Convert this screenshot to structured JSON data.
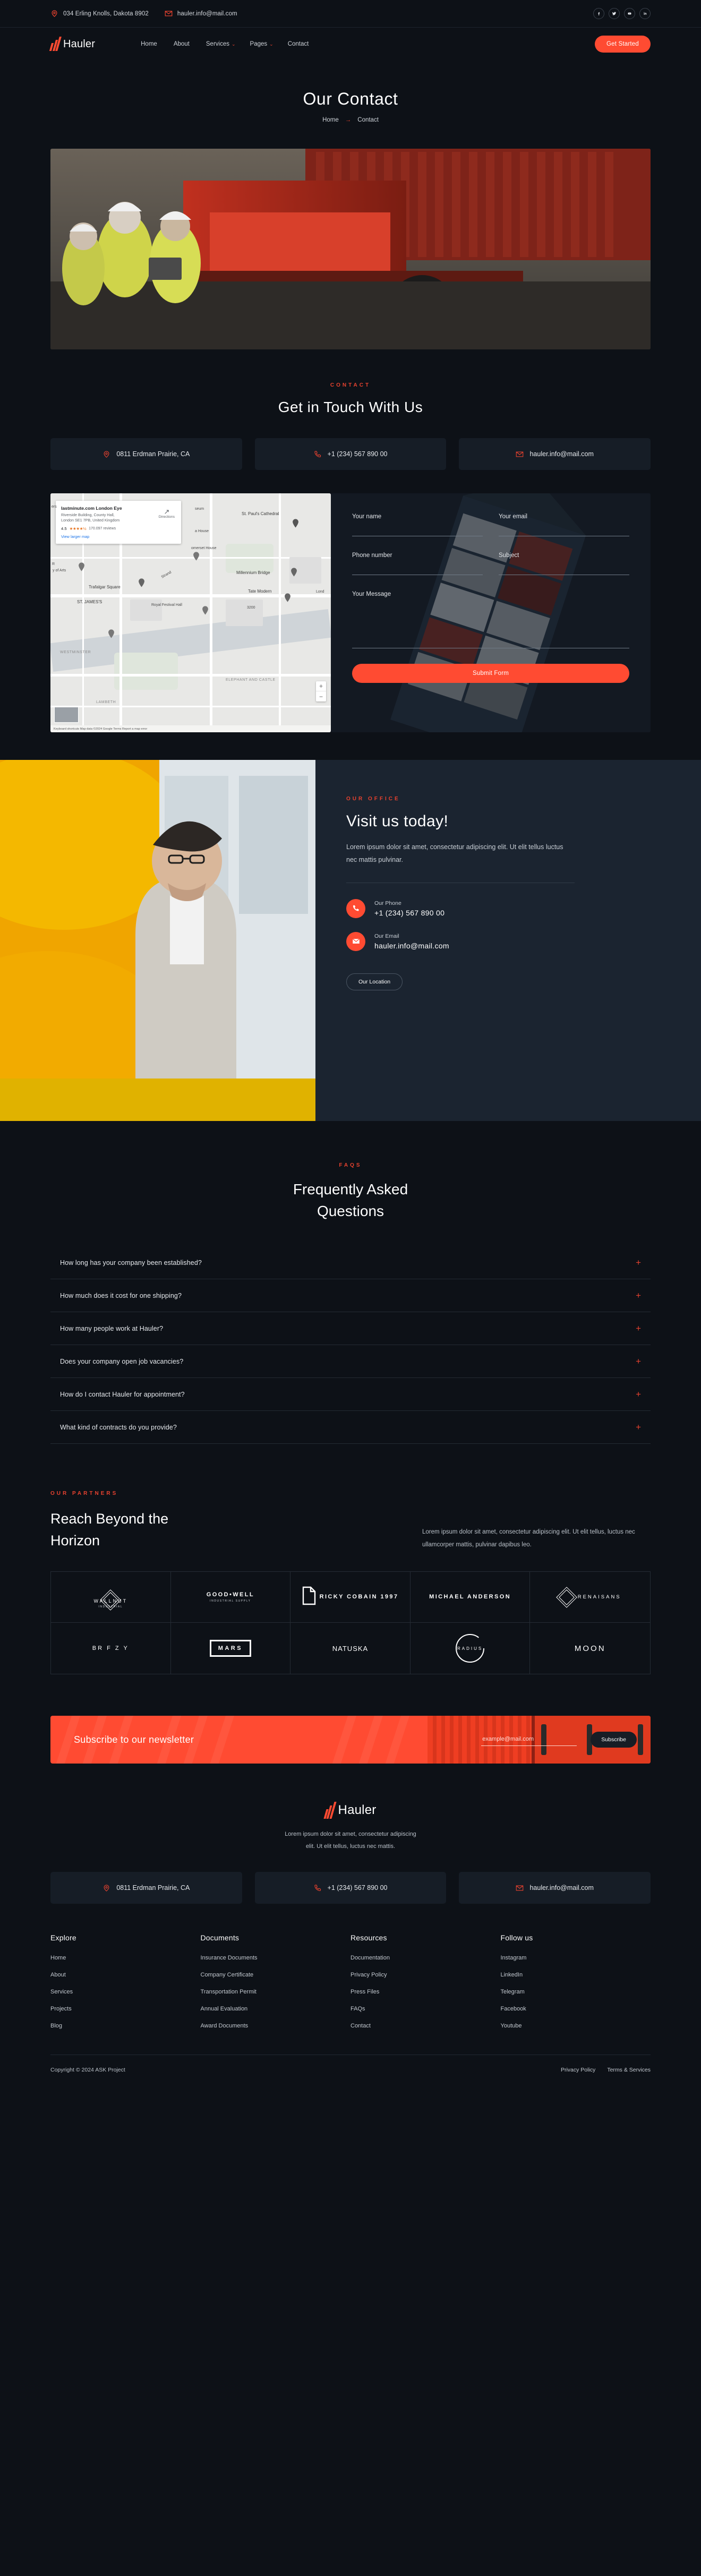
{
  "colors": {
    "accent": "#ff4b32",
    "accent_dark": "#e8422f",
    "bg": "#0d1117",
    "panel": "#161d26",
    "card": "#1b2430"
  },
  "topbar": {
    "address": "034 Erling Knolls, Dakota 8902",
    "email": "hauler.info@mail.com",
    "socials": [
      "facebook",
      "twitter",
      "youtube",
      "linkedin"
    ]
  },
  "nav": {
    "brand": "Hauler",
    "links": [
      {
        "label": "Home",
        "caret": ""
      },
      {
        "label": "About",
        "caret": ""
      },
      {
        "label": "Services",
        "caret": "⌄"
      },
      {
        "label": "Pages",
        "caret": "⌄"
      },
      {
        "label": "Contact",
        "caret": ""
      }
    ],
    "cta": "Get Started"
  },
  "hero": {
    "title": "Our Contact",
    "crumb_home": "Home",
    "crumb_arrow": "→",
    "crumb_current": "Contact"
  },
  "contact": {
    "eyebrow": "CONTACT",
    "title": "Get in Touch With Us",
    "cards": [
      {
        "icon": "location-pin-icon",
        "text": "0811 Erdman Prairie, CA"
      },
      {
        "icon": "phone-icon",
        "text": "+1 (234) 567 890 00"
      },
      {
        "icon": "envelope-icon",
        "text": "hauler.info@mail.com"
      }
    ]
  },
  "map": {
    "place_title": "lastminute.com London Eye",
    "address_line1": "Riverside Building, County Hall,",
    "address_line2": "London SE1 7PB, United Kingdom",
    "rating": "4.5",
    "stars": "★★★★½",
    "reviews": "170.097 reviews",
    "view_larger": "View larger map",
    "directions": "Directions",
    "zoom_in": "+",
    "zoom_out": "−",
    "footer_text": "Keyboard shortcuts   Map data ©2024 Google   Terms   Report a map error",
    "labels": [
      "Primark",
      "seum",
      "a House",
      "St. Paul's Cathedral",
      "omerset House",
      "Millennium Bridge",
      "Tate Modern",
      "Lond",
      "y of Arts",
      "Trafalgar Square",
      "Strand",
      "ST. JAMES'S",
      "Royal Festival Hall",
      "WESTMINSTER",
      "LAMBETH",
      "ELEPHANT AND CASTLE",
      "3200",
      "ers",
      "R"
    ]
  },
  "form": {
    "name_label": "Your name",
    "email_label": "Your email",
    "phone_label": "Phone number",
    "subject_label": "Subject",
    "message_label": "Your Message",
    "name_value": "",
    "email_value": "",
    "phone_value": "",
    "subject_value": "",
    "message_value": "",
    "submit": "Submit Form"
  },
  "office": {
    "eyebrow": "OUR OFFICE",
    "title": "Visit us today!",
    "lead": "Lorem ipsum dolor sit amet, consectetur adipiscing elit. Ut elit tellus luctus nec mattis pulvinar.",
    "phone_label": "Our Phone",
    "phone_value": "+1 (234) 567 890 00",
    "email_label": "Our Email",
    "email_value": "hauler.info@mail.com",
    "button": "Our Location"
  },
  "faq": {
    "eyebrow": "FAQS",
    "title_line1": "Frequently Asked",
    "title_line2": "Questions",
    "items": [
      "How long has your company been established?",
      "How much does it cost for one shipping?",
      "How many people work at Hauler?",
      "Does your company open job vacancies?",
      "How do I contact Hauler for appointment?",
      "What kind of contracts do you provide?"
    ],
    "expand_glyph": "+"
  },
  "partners": {
    "eyebrow": "OUR PARTNERS",
    "title_line1": "Reach Beyond the",
    "title_line2": "Horizon",
    "paragraph": "Lorem ipsum dolor sit amet, consectetur adipiscing elit. Ut elit tellus, luctus nec ullamcorper mattis, pulvinar dapibus leo.",
    "logos": [
      {
        "name": "WALLNUT",
        "sub": "INDUSTRIAL",
        "style": "diamond"
      },
      {
        "name": "GOOD•WELL",
        "sub": "INDUSTRIAL SUPPLY",
        "style": "stacked"
      },
      {
        "name": "RICKY COBAIN 1997",
        "sub": "",
        "style": "doc"
      },
      {
        "name": "MICHAEL ANDERSON",
        "sub": "",
        "style": "slash"
      },
      {
        "name": "RENAISANS",
        "sub": "",
        "style": "diamond-side"
      },
      {
        "name": "BR F Z Y",
        "sub": "",
        "style": "plain"
      },
      {
        "name": "MARS",
        "sub": "",
        "style": "boxed"
      },
      {
        "name": "NATUSKA",
        "sub": "",
        "style": "mixed"
      },
      {
        "name": "RADIUS",
        "sub": "",
        "style": "circle"
      },
      {
        "name": "MOON",
        "sub": "",
        "style": "plain"
      }
    ]
  },
  "newsletter": {
    "title": "Subscribe to our newsletter",
    "placeholder": "example@mail.com",
    "value": "",
    "button": "Subscribe"
  },
  "footer": {
    "brand": "Hauler",
    "tagline_line1": "Lorem ipsum dolor sit amet, consectetur adipiscing",
    "tagline_line2": "elit. Ut elit tellus, luctus nec mattis.",
    "cards": [
      {
        "icon": "location-pin-icon",
        "text": "0811 Erdman Prairie, CA"
      },
      {
        "icon": "phone-icon",
        "text": "+1 (234) 567 890 00"
      },
      {
        "icon": "envelope-icon",
        "text": "hauler.info@mail.com"
      }
    ],
    "columns": [
      {
        "title": "Explore",
        "links": [
          "Home",
          "About",
          "Services",
          "Projects",
          "Blog"
        ]
      },
      {
        "title": "Documents",
        "links": [
          "Insurance Documents",
          "Company Certificate",
          "Transportation Permit",
          "Annual Evaluation",
          "Award Documents"
        ]
      },
      {
        "title": "Resources",
        "links": [
          "Documentation",
          "Privacy Policy",
          "Press Files",
          "FAQs",
          "Contact"
        ]
      },
      {
        "title": "Follow us",
        "links": [
          "Instagram",
          "LinkedIn",
          "Telegram",
          "Facebook",
          "Youtube"
        ]
      }
    ],
    "copyright": "Copyright © 2024 ASK Project",
    "legal": [
      "Privacy Policy",
      "Terms & Services"
    ]
  }
}
